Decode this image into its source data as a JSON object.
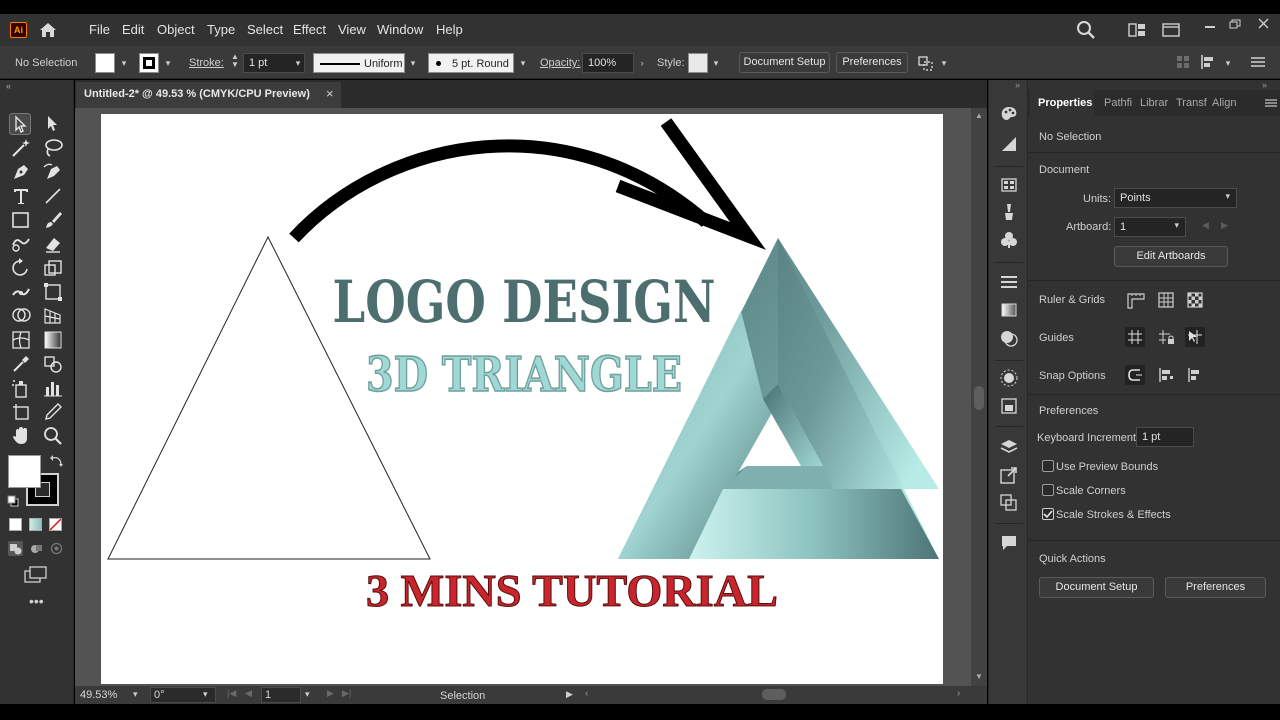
{
  "menubar": {
    "app_badge": "Ai",
    "items": [
      "File",
      "Edit",
      "Object",
      "Type",
      "Select",
      "Effect",
      "View",
      "Window",
      "Help"
    ]
  },
  "control": {
    "selection_status": "No Selection",
    "stroke_label": "Stroke:",
    "stroke_weight": "1 pt",
    "profile_label": "Uniform",
    "brush_label": "5 pt. Round",
    "opacity_label": "Opacity:",
    "opacity_value": "100%",
    "style_label": "Style:",
    "document_setup": "Document Setup",
    "preferences": "Preferences"
  },
  "document": {
    "tab_title": "Untitled-2* @ 49.53 % (CMYK/CPU Preview)",
    "close_glyph": "×"
  },
  "artwork": {
    "title_line": "LOGO DESIGN",
    "subtitle_line": "3D TRIANGLE",
    "footer_line": "3 MINS TUTORIAL",
    "colors": {
      "title": "#4d6e6e",
      "subtitle": "#9fd8d4",
      "footer": "#c8262c",
      "triangle_dark": "#587f80",
      "triangle_light": "#aee4df"
    }
  },
  "status": {
    "zoom": "49.53%",
    "rotation": "0°",
    "artboard_number": "1",
    "tool_name": "Selection"
  },
  "panel": {
    "tabs": [
      "Properties",
      "Pathfi",
      "Librar",
      "Transf",
      "Align"
    ],
    "active_tab": "Properties",
    "selection": "No Selection",
    "document_heading": "Document",
    "units_label": "Units:",
    "units_value": "Points",
    "artboard_label": "Artboard:",
    "artboard_value": "1",
    "edit_artboards": "Edit Artboards",
    "ruler_grids": "Ruler & Grids",
    "guides": "Guides",
    "snap_options": "Snap Options",
    "preferences_heading": "Preferences",
    "keyboard_increment_label": "Keyboard Increment:",
    "keyboard_increment_value": "1 pt",
    "checkboxes": [
      {
        "label": "Use Preview Bounds",
        "checked": false
      },
      {
        "label": "Scale Corners",
        "checked": false
      },
      {
        "label": "Scale Strokes & Effects",
        "checked": true
      }
    ],
    "quick_actions": "Quick Actions",
    "qa_document_setup": "Document Setup",
    "qa_preferences": "Preferences"
  }
}
